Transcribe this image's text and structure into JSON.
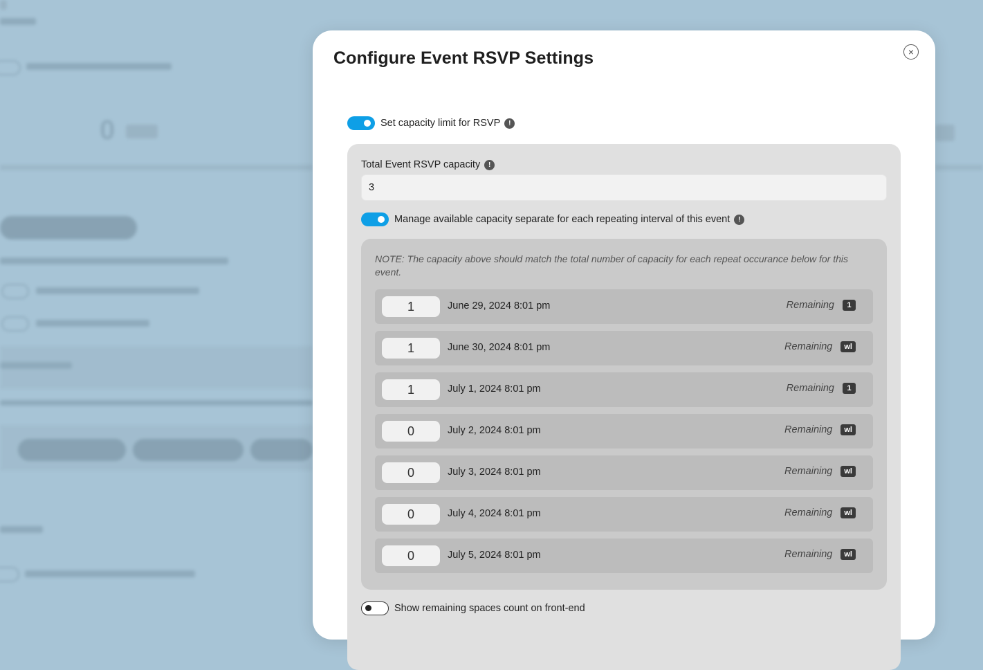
{
  "modal": {
    "title": "Configure Event RSVP Settings",
    "close_symbol": "×"
  },
  "capacity_limit": {
    "label": "Set capacity limit for RSVP",
    "enabled": true
  },
  "total_capacity": {
    "label": "Total Event RSVP capacity",
    "value": "3"
  },
  "manage_separately": {
    "label": "Manage available capacity separate for each repeating interval of this event",
    "enabled": true
  },
  "note": "NOTE: The capacity above should match the total number of capacity for each repeat occurance below for this event.",
  "occurrences": [
    {
      "capacity": "1",
      "date": "June 29, 2024 8:01 pm",
      "remaining_label": "Remaining",
      "remaining": "1"
    },
    {
      "capacity": "1",
      "date": "June 30, 2024 8:01 pm",
      "remaining_label": "Remaining",
      "remaining": "wl"
    },
    {
      "capacity": "1",
      "date": "July 1, 2024 8:01 pm",
      "remaining_label": "Remaining",
      "remaining": "1"
    },
    {
      "capacity": "0",
      "date": "July 2, 2024 8:01 pm",
      "remaining_label": "Remaining",
      "remaining": "wl"
    },
    {
      "capacity": "0",
      "date": "July 3, 2024 8:01 pm",
      "remaining_label": "Remaining",
      "remaining": "wl"
    },
    {
      "capacity": "0",
      "date": "July 4, 2024 8:01 pm",
      "remaining_label": "Remaining",
      "remaining": "wl"
    },
    {
      "capacity": "0",
      "date": "July 5, 2024 8:01 pm",
      "remaining_label": "Remaining",
      "remaining": "wl"
    }
  ],
  "show_remaining": {
    "label": "Show remaining spaces count on front-end",
    "enabled": false
  },
  "icons": {
    "info": "!",
    "info_icon_name": "info-icon",
    "close_icon_name": "close-icon"
  },
  "colors": {
    "toggle_on": "#0e9fe6",
    "panel_bg": "#e0e0e0",
    "occurrence_panel_bg": "#cacaca",
    "badge_bg": "#3a3a3a"
  }
}
